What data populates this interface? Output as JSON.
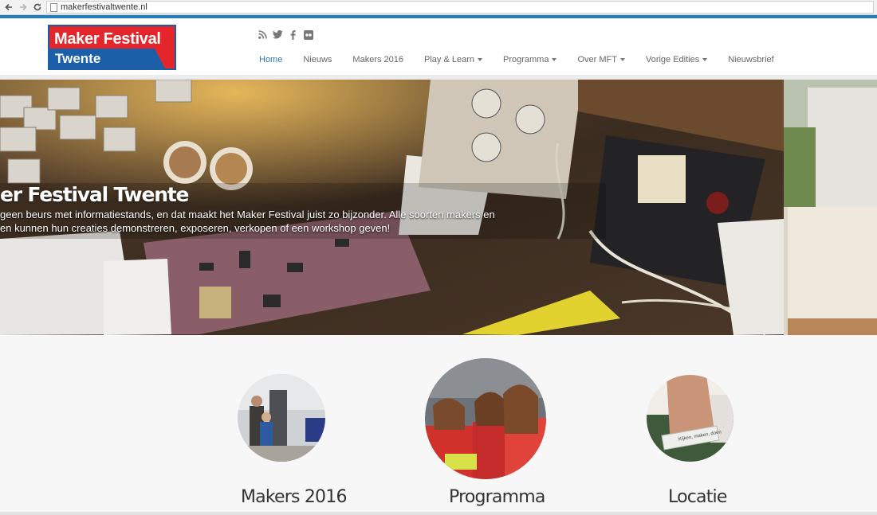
{
  "browser": {
    "url": "makerfestivaltwente.nl"
  },
  "header": {
    "logo": {
      "line1": "Maker Festival",
      "line2": "Twente"
    },
    "social_icons": [
      "rss-icon",
      "twitter-icon",
      "facebook-icon",
      "flickr-icon"
    ],
    "nav": [
      {
        "label": "Home",
        "active": true,
        "dropdown": false
      },
      {
        "label": "Nieuws",
        "active": false,
        "dropdown": false
      },
      {
        "label": "Makers 2016",
        "active": false,
        "dropdown": false
      },
      {
        "label": "Play & Learn",
        "active": false,
        "dropdown": true
      },
      {
        "label": "Programma",
        "active": false,
        "dropdown": true
      },
      {
        "label": "Over MFT",
        "active": false,
        "dropdown": true
      },
      {
        "label": "Vorige Edities",
        "active": false,
        "dropdown": true
      },
      {
        "label": "Nieuwsbrief",
        "active": false,
        "dropdown": false
      }
    ]
  },
  "hero": {
    "title": "er Festival Twente",
    "line1": "geen beurs met informatiestands, en dat maakt het Maker Festival juist zo bijzonder. Alle soorten makers en",
    "line2": "en kunnen hun creaties demonstreren, exposeren, verkopen of een workshop geven!"
  },
  "features": [
    {
      "title": "Makers 2016"
    },
    {
      "title": "Programma"
    },
    {
      "title": "Locatie"
    }
  ],
  "colors": {
    "brand_blue": "#1f7fc0",
    "logo_red": "#e4262a",
    "nav_active": "#2a7ab8"
  }
}
